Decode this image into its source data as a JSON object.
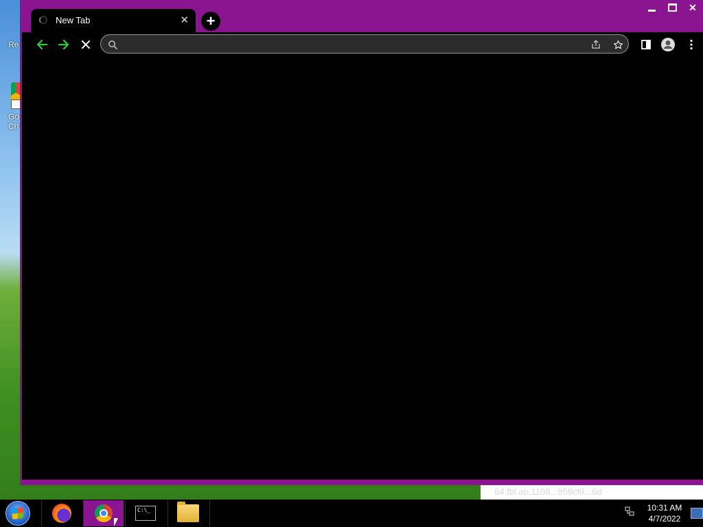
{
  "desktop": {
    "icon_label_1": "Re",
    "icon_label_2": "Go",
    "icon_label_3": "Ch"
  },
  "window_controls": {
    "minimize": "—",
    "maximize": "☐",
    "close": "✕"
  },
  "tab": {
    "title": "New Tab",
    "close_glyph": "✕",
    "new_tab_glyph": "+"
  },
  "toolbar": {
    "omnibox_value": "",
    "omnibox_placeholder": ""
  },
  "status_text": "64.fbl.ap.1108...959cf9...6d",
  "taskbar": {
    "items": [
      "firefox",
      "chrome",
      "cmd",
      "explorer"
    ],
    "cmd_text": "C:\\_",
    "clock_time": "10:31 AM",
    "clock_date": "4/7/2022"
  },
  "colors": {
    "window_frame": "#8b1591",
    "nav_arrow": "#2ecc40",
    "toolbar_bg": "#000000"
  }
}
